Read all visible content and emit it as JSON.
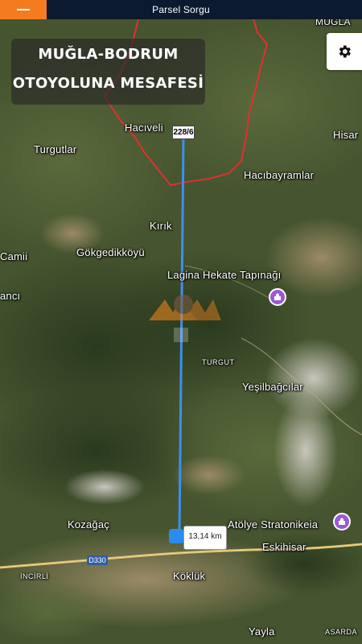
{
  "topbar": {
    "title": "Parsel Sorgu",
    "menu_icon": "hamburger-icon"
  },
  "settings": {
    "icon": "gear-icon"
  },
  "overlay": {
    "line1": "MUĞLA-BODRUM",
    "line2": "OTOYOLUNA MESAFESİ"
  },
  "parcel": {
    "label": "228/6"
  },
  "measurement": {
    "distance": "13,14 km"
  },
  "road": {
    "shield": "D330"
  },
  "places": [
    {
      "name": "MUĞLA"
    },
    {
      "name": "Hacıveli"
    },
    {
      "name": "Hisar"
    },
    {
      "name": "Turgutlar"
    },
    {
      "name": "Hacıbayramlar"
    },
    {
      "name": "Kırık"
    },
    {
      "name": "Camii"
    },
    {
      "name": "Gökgedikköyü"
    },
    {
      "name": "Lagina Hekate Tapınağı"
    },
    {
      "name": "ancı"
    },
    {
      "name": "TURGUT"
    },
    {
      "name": "Yeşilbağcılar"
    },
    {
      "name": "Kozağaç"
    },
    {
      "name": "Atölye Stratonikeia"
    },
    {
      "name": "Eskihisar"
    },
    {
      "name": "Köklük"
    },
    {
      "name": "İNCİRLİ"
    },
    {
      "name": "Yayla"
    },
    {
      "name": "ASARDA"
    }
  ],
  "colors": {
    "accent": "#f47b20",
    "route": "#3d8ff0",
    "boundary": "#e03030",
    "poi": "#9b59d8",
    "topbar": "#0b1a2e"
  }
}
